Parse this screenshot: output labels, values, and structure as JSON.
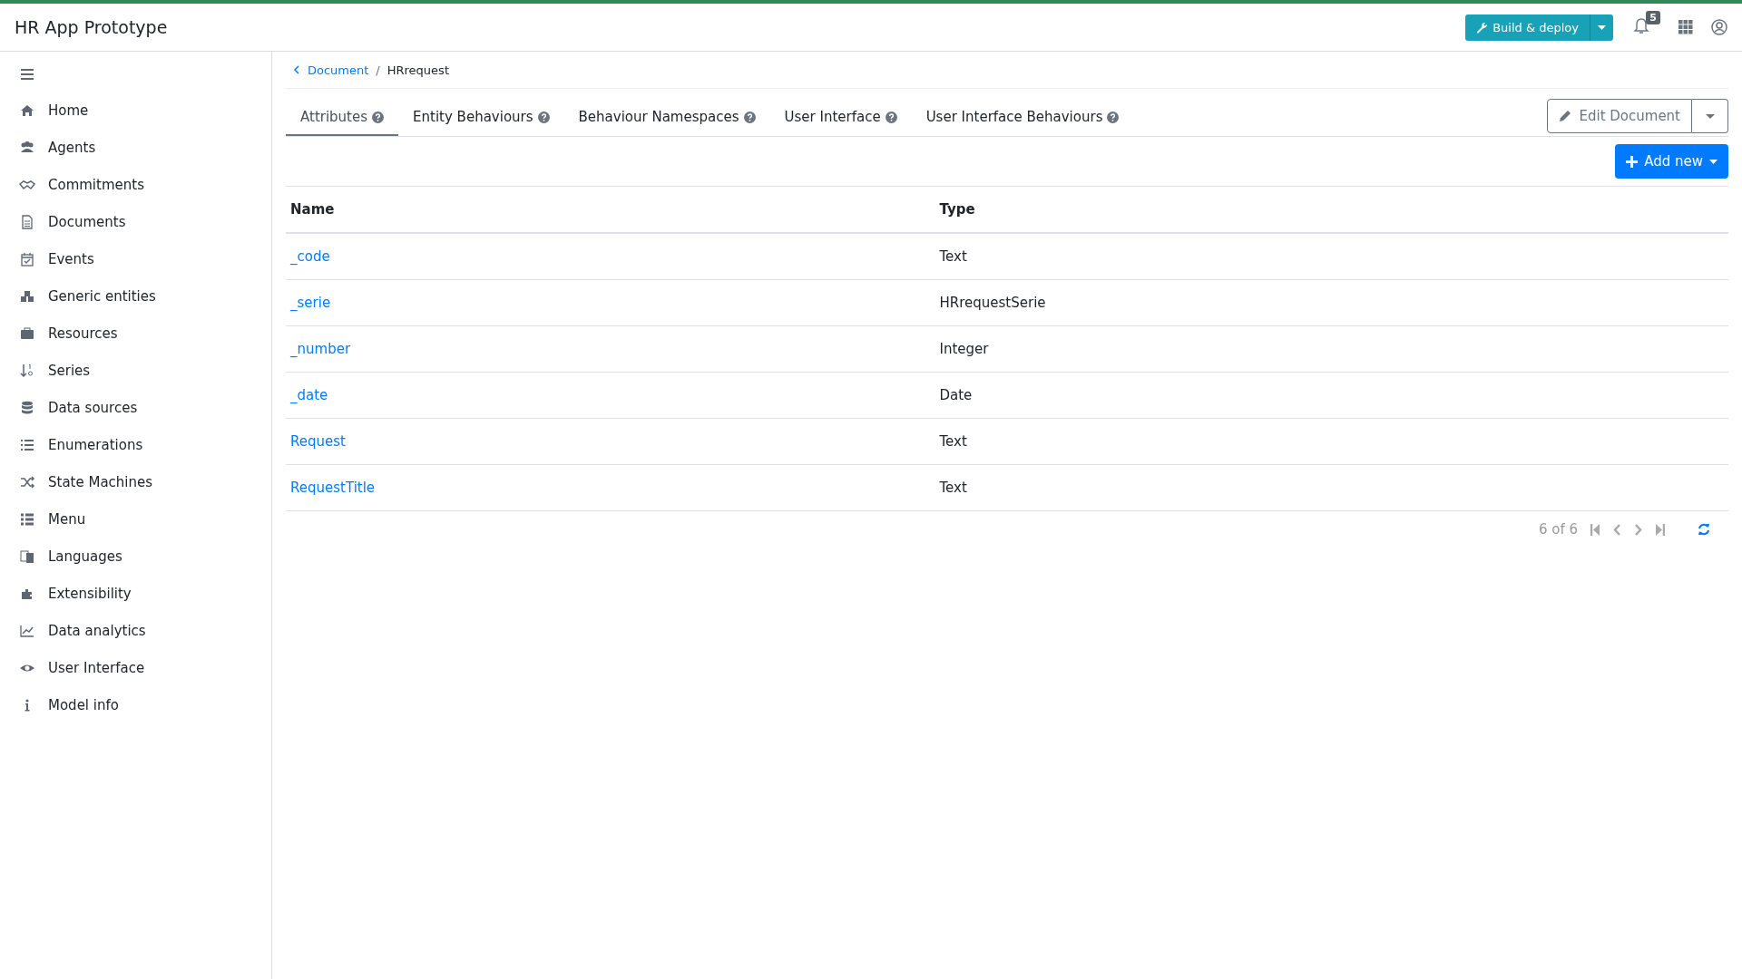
{
  "app_title": "HR App Prototype",
  "header": {
    "build_button": "Build & deploy",
    "notifications_count": "5"
  },
  "sidebar": {
    "items": [
      {
        "label": "Home"
      },
      {
        "label": "Agents"
      },
      {
        "label": "Commitments"
      },
      {
        "label": "Documents"
      },
      {
        "label": "Events"
      },
      {
        "label": "Generic entities"
      },
      {
        "label": "Resources"
      },
      {
        "label": "Series"
      },
      {
        "label": "Data sources"
      },
      {
        "label": "Enumerations"
      },
      {
        "label": "State Machines"
      },
      {
        "label": "Menu"
      },
      {
        "label": "Languages"
      },
      {
        "label": "Extensibility"
      },
      {
        "label": "Data analytics"
      },
      {
        "label": "User Interface"
      },
      {
        "label": "Model info"
      }
    ]
  },
  "breadcrumb": {
    "parent": "Document",
    "separator": "/",
    "current": "HRrequest"
  },
  "tabs": [
    {
      "label": "Attributes",
      "selected": true
    },
    {
      "label": "Entity Behaviours",
      "selected": false
    },
    {
      "label": "Behaviour Namespaces",
      "selected": false
    },
    {
      "label": "User Interface",
      "selected": false
    },
    {
      "label": "User Interface Behaviours",
      "selected": false
    }
  ],
  "edit_button": "Edit Document",
  "add_button": "Add new",
  "table": {
    "columns": [
      "Name",
      "Type"
    ],
    "rows": [
      {
        "name": "_code",
        "type": "Text"
      },
      {
        "name": "_serie",
        "type": "HRrequestSerie"
      },
      {
        "name": "_number",
        "type": "Integer"
      },
      {
        "name": "_date",
        "type": "Date"
      },
      {
        "name": "Request",
        "type": "Text"
      },
      {
        "name": "RequestTitle",
        "type": "Text"
      }
    ]
  },
  "pagination": {
    "summary": "6 of 6"
  }
}
